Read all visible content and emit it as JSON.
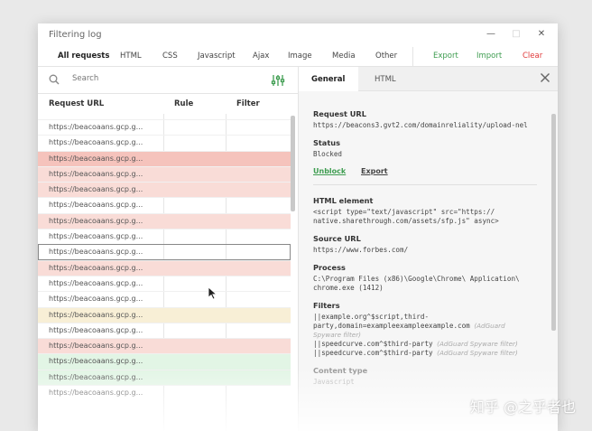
{
  "window": {
    "title": "Filtering log"
  },
  "tabs": [
    "All requests",
    "HTML",
    "CSS",
    "Javascript",
    "Ajax",
    "Image",
    "Media",
    "Other"
  ],
  "actions": {
    "export": "Export",
    "import": "Import",
    "clear": "Clear"
  },
  "search": {
    "placeholder": "Search"
  },
  "columns": {
    "url": "Request URL",
    "rule": "Rule",
    "filter": "Filter"
  },
  "rows": [
    {
      "url": "https://beacoaans.gcp.g...",
      "state": "none"
    },
    {
      "url": "https://beacoaans.gcp.g...",
      "state": "none"
    },
    {
      "url": "https://beacoaans.gcp.g...",
      "state": "red"
    },
    {
      "url": "https://beacoaans.gcp.g...",
      "state": "pink"
    },
    {
      "url": "https://beacoaans.gcp.g...",
      "state": "pink"
    },
    {
      "url": "https://beacoaans.gcp.g...",
      "state": "none"
    },
    {
      "url": "https://beacoaans.gcp.g...",
      "state": "pink"
    },
    {
      "url": "https://beacoaans.gcp.g...",
      "state": "none"
    },
    {
      "url": "https://beacoaans.gcp.g...",
      "state": "selected"
    },
    {
      "url": "https://beacoaans.gcp.g...",
      "state": "pink"
    },
    {
      "url": "https://beacoaans.gcp.g...",
      "state": "none"
    },
    {
      "url": "https://beacoaans.gcp.g...",
      "state": "none"
    },
    {
      "url": "https://beacoaans.gcp.g...",
      "state": "yellow"
    },
    {
      "url": "https://beacoaans.gcp.g...",
      "state": "none"
    },
    {
      "url": "https://beacoaans.gcp.g...",
      "state": "pink"
    },
    {
      "url": "https://beacoaans.gcp.g...",
      "state": "greenbg"
    },
    {
      "url": "https://beacoaans.gcp.g...",
      "state": "greenbg"
    },
    {
      "url": "https://beacoaans.gcp.g...",
      "state": "none"
    }
  ],
  "details": {
    "tabs": {
      "general": "General",
      "html": "HTML"
    },
    "request_url_label": "Request URL",
    "request_url": "https://beacons3.gvt2.com/domainreliality/upload-nel",
    "status_label": "Status",
    "status": "Blocked",
    "unblock": "Unblock",
    "export": "Export",
    "html_element_label": "HTML element",
    "html_element_1": "<script type=\"text/javascript\" src=\"https://",
    "html_element_2": "native.sharethrough.com/assets/sfp.js\" async>",
    "source_url_label": "Source URL",
    "source_url": "https://www.forbes.com/",
    "process_label": "Process",
    "process_1": "C:\\Program Files (x86)\\Google\\Chrome\\ Application\\",
    "process_2": "chrome.exe (1412)",
    "filters_label": "Filters",
    "filter_1a": "||example.org^$script,third-",
    "filter_1b": "party,domain=exampleexampleexample.com",
    "filter_1_note_a": "(AdGuard",
    "filter_1_note_b": "Spyware filter)",
    "filter_2": "||speedcurve.com^$third-party",
    "filter_2_note": "(AdGuard Spyware filter)",
    "filter_3": "||speedcurve.com^$third-party",
    "filter_3_note": "(AdGuard Spyware filter)",
    "content_type_label": "Content type",
    "content_type": "Javascript"
  },
  "watermark": "知乎 @之乎者也",
  "colors": {
    "accent_green": "#3f9d51",
    "clear_red": "#e0393a",
    "blocked_row": "#f5c3bc",
    "pink_row": "#f9dcd7"
  }
}
